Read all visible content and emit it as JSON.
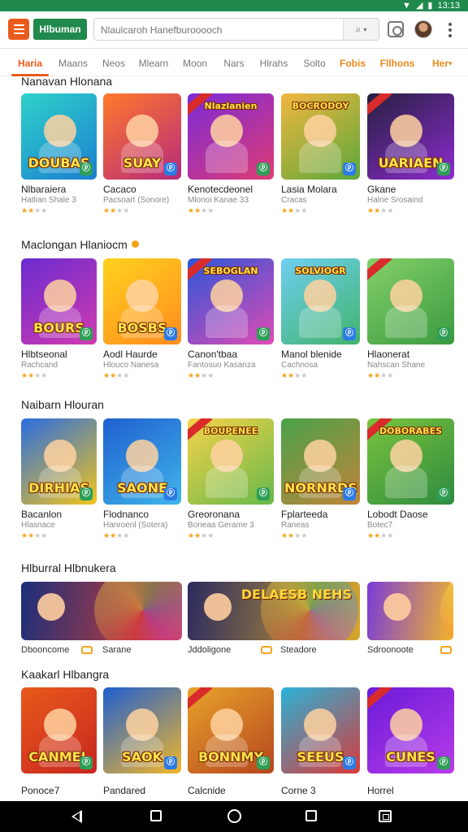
{
  "status_bar": {
    "time": "13:13"
  },
  "app_bar": {
    "app_chip": "Hlbuman",
    "search": {
      "value": "Nlaulcaroh Hanefburooooch",
      "placeholder": "Nlaulcaroh Hanefburooooch"
    }
  },
  "tabs": [
    {
      "label": "Haria",
      "state": "active"
    },
    {
      "label": "Maans",
      "state": "normal"
    },
    {
      "label": "Neos",
      "state": "normal"
    },
    {
      "label": "Mlearn",
      "state": "normal"
    },
    {
      "label": "Moon",
      "state": "normal"
    },
    {
      "label": "Nars",
      "state": "normal"
    },
    {
      "label": "Hlrahs",
      "state": "normal"
    },
    {
      "label": "Solto",
      "state": "normal"
    },
    {
      "label": "Fobis",
      "state": "warm"
    },
    {
      "label": "Fllhons",
      "state": "warm"
    },
    {
      "label": "Her",
      "state": "warm"
    }
  ],
  "sections": [
    {
      "title": "Nanavan Hlonana",
      "apps": [
        {
          "art": "DOUBAS",
          "name": "Nlbaraiera",
          "sub": "Hatlian Shale 3",
          "rating": 2,
          "colors": [
            "#2fd2c9",
            "#1b7fd1"
          ]
        },
        {
          "art": "SUAY",
          "name": "Cacaco",
          "sub": "Pacsoart (Sonore)",
          "rating": 2,
          "colors": [
            "#ff7a2b",
            "#b7297c"
          ]
        },
        {
          "art": "Nlazlanien",
          "name": "Kenotecdeonel",
          "sub": "Mlonoi Kanae 33",
          "rating": 2,
          "colors": [
            "#7a2bd8",
            "#e03b74"
          ]
        },
        {
          "art": "BOCRODOY",
          "name": "Lasia Molara",
          "sub": "Cracas",
          "rating": 2,
          "colors": [
            "#f2b640",
            "#5aa83a"
          ]
        },
        {
          "art": "UARIAEN",
          "name": "Gkane",
          "sub": "Halne Srosaind",
          "rating": 2,
          "colors": [
            "#25203f",
            "#8e2bd0"
          ]
        }
      ]
    },
    {
      "title": "Maclongan Hlaniocm",
      "apps": [
        {
          "art": "BOURS",
          "name": "Hlbtseonal",
          "sub": "Rachcand",
          "rating": 2,
          "colors": [
            "#6a2bd0",
            "#d23bb0"
          ]
        },
        {
          "art": "BOSBS",
          "name": "Aodl Haurde",
          "sub": "Hlouco Nanesa",
          "rating": 2,
          "colors": [
            "#ffd21e",
            "#ff8b1e"
          ]
        },
        {
          "art": "SEBOGLAN",
          "name": "Canon'tbaa",
          "sub": "Fantosuo Kasanza",
          "rating": 2,
          "colors": [
            "#2b56d8",
            "#e04bb4"
          ]
        },
        {
          "art": "SOLVIOGR",
          "name": "Manol blenide",
          "sub": "Cachnosa",
          "rating": 2,
          "colors": [
            "#6fcff2",
            "#41b36b"
          ]
        },
        {
          "art": "",
          "name": "Hlaonerat",
          "sub": "Nahscan Shane",
          "rating": 2,
          "colors": [
            "#84d06a",
            "#3a9a3f"
          ]
        }
      ]
    },
    {
      "title": "Naibarn Hlouran",
      "apps": [
        {
          "art": "DIRHIAS",
          "name": "Bacanlon",
          "sub": "Hlasnace",
          "rating": 2,
          "colors": [
            "#2a6de0",
            "#f2c41e"
          ]
        },
        {
          "art": "SAONE",
          "name": "Flodnanco",
          "sub": "Hanroenl (Sotera)",
          "rating": 2,
          "colors": [
            "#1f5fd0",
            "#3fb5e8"
          ]
        },
        {
          "art": "BOUPENEE",
          "name": "Greoronana",
          "sub": "Boneaa Gerame 3",
          "rating": 2,
          "colors": [
            "#f7d24a",
            "#66b94a"
          ]
        },
        {
          "art": "NORNRDS",
          "name": "Fplarteeda",
          "sub": "Raneas",
          "rating": 2,
          "colors": [
            "#4aa24a",
            "#c0843a"
          ]
        },
        {
          "art": "DOBORABES",
          "name": "Lobodt Daose",
          "sub": "Botec7",
          "rating": 2,
          "colors": [
            "#79c43e",
            "#2e8a3f"
          ]
        }
      ]
    },
    {
      "title": "Hlburral Hlbnukera",
      "banners": [
        {
          "art": "",
          "name": "Dbooncome",
          "price": "Sarane",
          "colors": [
            "#1b2f7a",
            "#e8402b"
          ]
        },
        {
          "art": "DELAESB NEHS",
          "name": "Jddoligone",
          "price": "Steadore",
          "colors": [
            "#2b2a5f",
            "#d8a82b"
          ]
        },
        {
          "art": "",
          "name": "Sdroonoote",
          "price": "",
          "colors": [
            "#7a3bd8",
            "#f2b62b"
          ]
        }
      ]
    },
    {
      "title": "Kaakarl Hlbangra",
      "apps": [
        {
          "art": "CANMEL",
          "name": "Ponoce7",
          "sub": "",
          "rating": 0,
          "colors": [
            "#e85a1c",
            "#c8261e"
          ]
        },
        {
          "art": "SAOK",
          "name": "Pandared",
          "sub": "",
          "rating": 0,
          "colors": [
            "#1e5fd0",
            "#f2b62b"
          ]
        },
        {
          "art": "BONNMY",
          "name": "Calcnide",
          "sub": "",
          "rating": 0,
          "colors": [
            "#e8a22b",
            "#b5461e"
          ]
        },
        {
          "art": "SEEUS",
          "name": "Corne 3",
          "sub": "",
          "rating": 0,
          "colors": [
            "#2ab3d8",
            "#d83a3a"
          ]
        },
        {
          "art": "CUNES",
          "name": "Horrel",
          "sub": "",
          "rating": 0,
          "colors": [
            "#6a1bd8",
            "#b83be8"
          ]
        }
      ]
    }
  ],
  "icons": {
    "menu": "menu-icon",
    "search": "search-icon",
    "cast": "cast-icon",
    "more": "more-vert-icon",
    "back": "back-icon",
    "home": "home-icon",
    "recents": "recents-icon"
  },
  "colors": {
    "primary": "#1f8a4c",
    "accent": "#e95b1c",
    "star": "#f2a31c"
  }
}
